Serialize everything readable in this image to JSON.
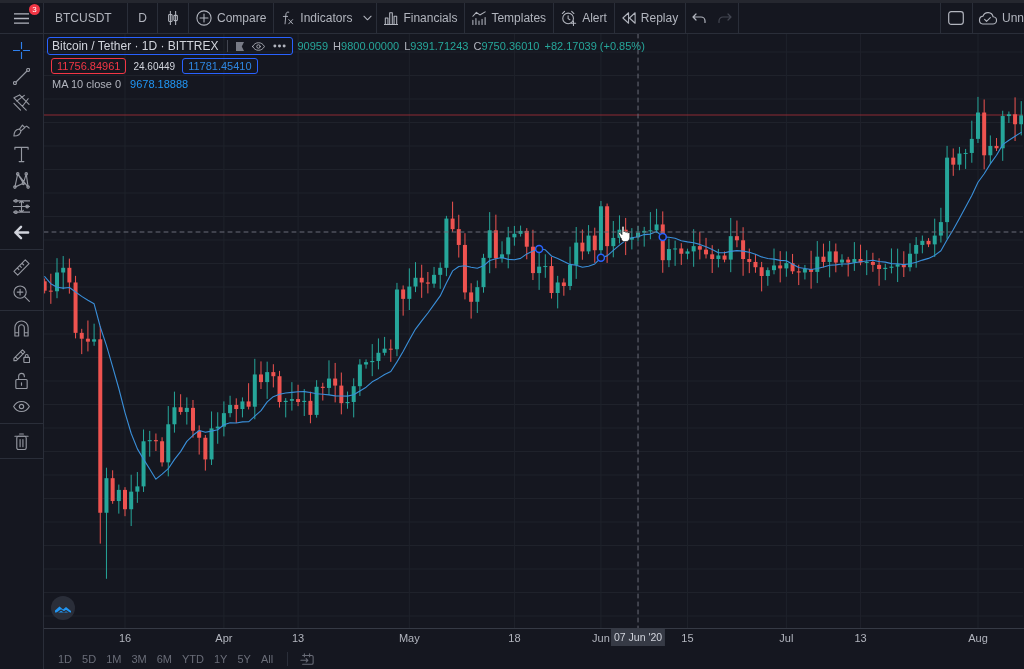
{
  "toolbar": {
    "menu_badge": "3",
    "symbol": "BTCUSDT",
    "interval": "D",
    "buttons": [
      {
        "kind": "compare",
        "label": "Compare",
        "dropdown": false
      },
      {
        "kind": "indicators",
        "label": "Indicators",
        "dropdown": true
      },
      {
        "kind": "financials",
        "label": "Financials",
        "dropdown": false
      },
      {
        "kind": "templates",
        "label": "Templates",
        "dropdown": false
      },
      {
        "kind": "alert",
        "label": "Alert",
        "dropdown": false
      },
      {
        "kind": "replay",
        "label": "Replay",
        "dropdown": false
      }
    ],
    "undo": {
      "disabled": false
    },
    "redo": {
      "disabled": true
    },
    "save_label": "Unn"
  },
  "drawing_toolbar": [
    [
      {
        "kind": "crosshair",
        "selected": true
      },
      {
        "kind": "trend_line",
        "selected": false
      },
      {
        "kind": "pitchfork",
        "selected": false
      },
      {
        "kind": "brush",
        "selected": false
      },
      {
        "kind": "text",
        "selected": false
      },
      {
        "kind": "pattern",
        "selected": false
      },
      {
        "kind": "prediction",
        "selected": false
      },
      {
        "kind": "hide",
        "selected": false
      }
    ],
    [
      {
        "kind": "ruler",
        "selected": false
      },
      {
        "kind": "zoom",
        "selected": false
      }
    ],
    [
      {
        "kind": "magnet",
        "selected": false
      },
      {
        "kind": "lock_drawing",
        "selected": false
      },
      {
        "kind": "lock",
        "selected": false
      },
      {
        "kind": "visibility",
        "selected": false
      }
    ],
    [
      {
        "kind": "trash",
        "selected": false
      }
    ]
  ],
  "legend": {
    "title": "Bitcoin / Tether · 1D · BITTREX",
    "ohlc": [
      {
        "value": "90959"
      },
      {
        "label": "H",
        "value": "9800.00000"
      },
      {
        "label": "L",
        "value": "9391.71243"
      },
      {
        "label": "C",
        "value": "9750.36010"
      }
    ],
    "change": "+82.17039 (+0.85%)",
    "sell_price": "11756.84961",
    "spread": "24.60449",
    "buy_price": "11781.45410",
    "indicator": {
      "name": "MA 10 close 0",
      "value": "9678.18888"
    }
  },
  "time_axis": {
    "labels": [
      "16",
      "Apr",
      "13",
      "May",
      "18",
      "Jun",
      "15",
      "Jul",
      "13",
      "Aug"
    ],
    "crosshair_label": "07 Jun '20"
  },
  "date_ranges": [
    {
      "label": "1D",
      "selected": false
    },
    {
      "label": "5D",
      "selected": false
    },
    {
      "label": "1M",
      "selected": false
    },
    {
      "label": "3M",
      "selected": false
    },
    {
      "label": "6M",
      "selected": false
    },
    {
      "label": "YTD",
      "selected": false
    },
    {
      "label": "1Y",
      "selected": false
    },
    {
      "label": "5Y",
      "selected": false
    },
    {
      "label": "All",
      "selected": false
    }
  ]
}
